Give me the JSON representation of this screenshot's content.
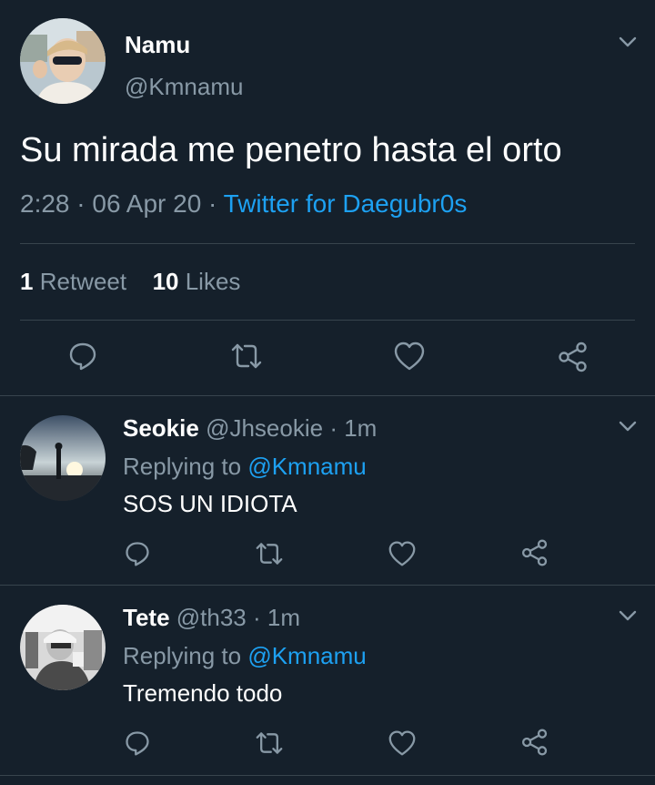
{
  "main_tweet": {
    "display_name": "Namu",
    "handle": "@Kmnamu",
    "text": "Su mirada me penetro hasta el orto",
    "time": "2:28",
    "date": "06 Apr 20",
    "source": "Twitter for Daegubr0s",
    "retweet_count": "1",
    "retweet_label": "Retweet",
    "like_count": "10",
    "like_label": "Likes",
    "separator": "·"
  },
  "replies": [
    {
      "display_name": "Seokie",
      "handle": "@Jhseokie",
      "time": "1m",
      "replying_prefix": "Replying to",
      "replying_to": "@Kmnamu",
      "text": "SOS UN IDIOTA"
    },
    {
      "display_name": "Tete",
      "handle": "@th33",
      "time": "1m",
      "replying_prefix": "Replying to",
      "replying_to": "@Kmnamu",
      "text": "Tremendo todo"
    }
  ],
  "icons": {
    "reply": "comment-icon",
    "retweet": "retweet-icon",
    "like": "heart-icon",
    "share": "share-icon",
    "menu": "chevron-down-icon"
  },
  "colors": {
    "background": "#15202b",
    "accent": "#1da1f2",
    "secondary_text": "#8899a6",
    "divider": "#38444d"
  }
}
